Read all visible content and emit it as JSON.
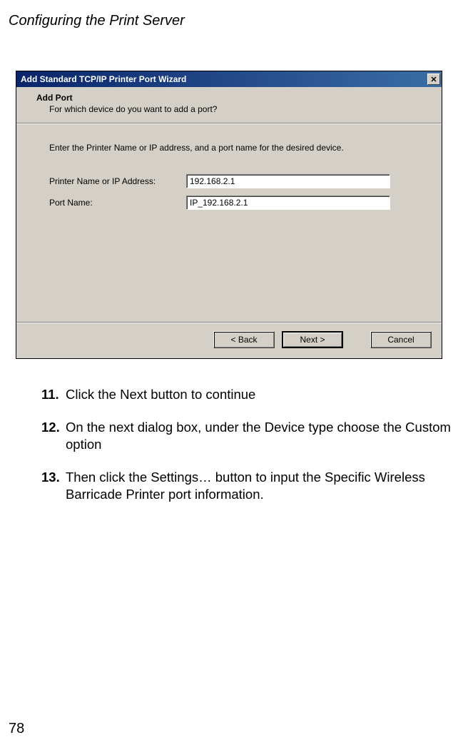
{
  "header": "Configuring the Print Server",
  "page_number": "78",
  "dialog": {
    "title": "Add Standard TCP/IP Printer Port Wizard",
    "close_glyph": "✕",
    "banner_title": "Add Port",
    "banner_sub": "For which device do you want to add a port?",
    "instruction": "Enter the Printer Name or IP address, and a port name for the desired device.",
    "field1_label": "Printer Name or IP Address:",
    "field1_value": "192.168.2.1",
    "field2_label": "Port Name:",
    "field2_value": "IP_192.168.2.1",
    "back_label": "< Back",
    "next_label": "Next >",
    "cancel_label": "Cancel"
  },
  "steps": {
    "s11_num": "11.",
    "s11_text": "Click the Next button to continue",
    "s12_num": "12.",
    "s12_text": "On the next dialog box, under the Device type choose the Custom option",
    "s13_num": "13.",
    "s13_text": "Then click the Settings… button to input the Specific Wireless Barricade Printer port information."
  }
}
